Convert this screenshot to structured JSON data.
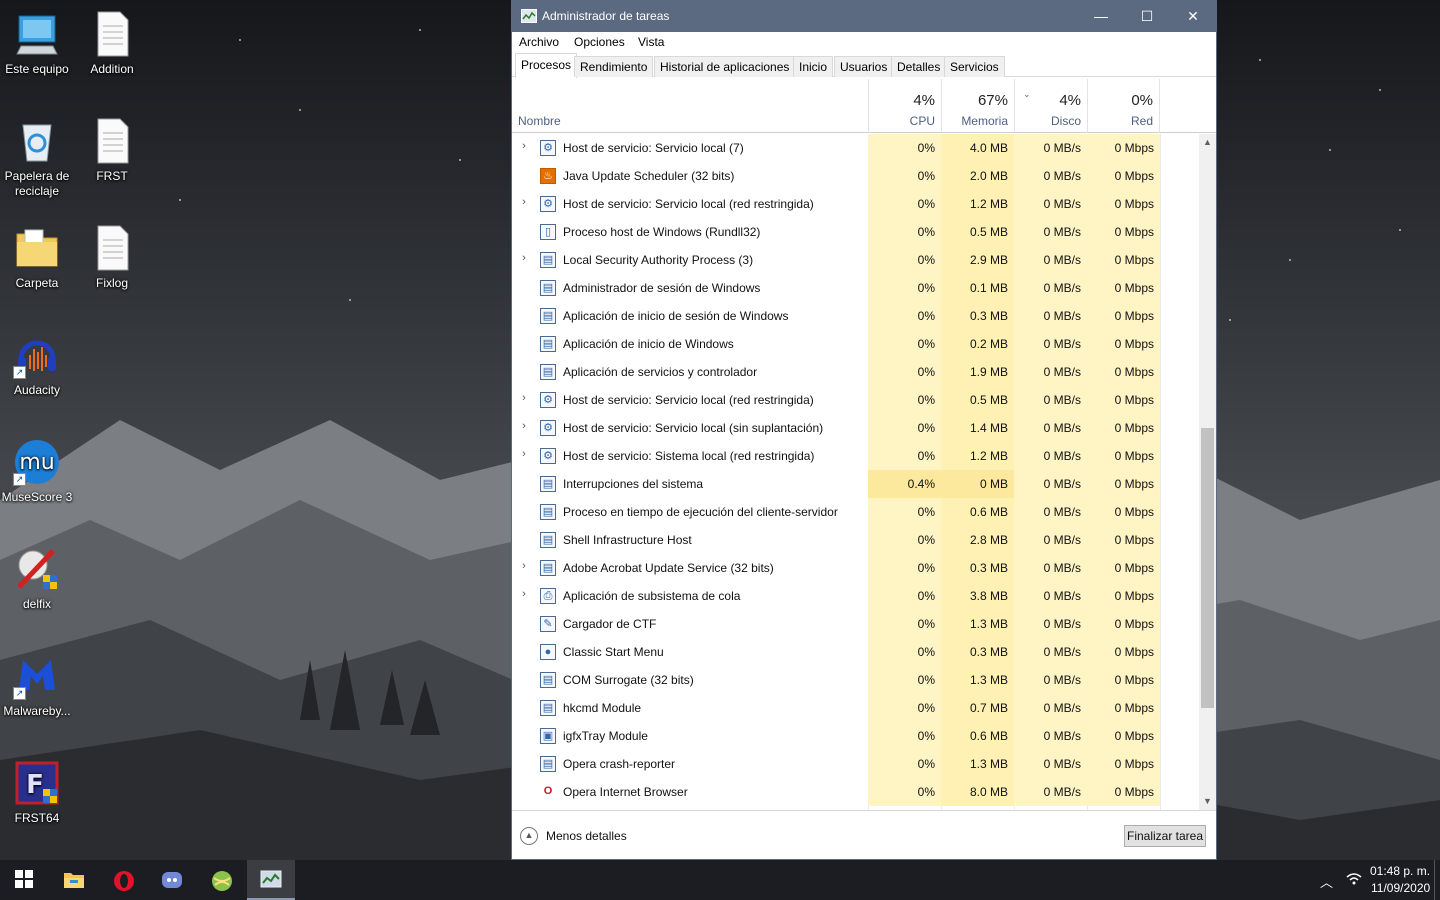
{
  "desktop": {
    "icons": [
      {
        "label": "Este equipo",
        "icon": "computer-icon"
      },
      {
        "label": "Addition",
        "icon": "text-file-icon"
      },
      {
        "label": "Papelera de reciclaje",
        "icon": "recycle-bin-icon"
      },
      {
        "label": "FRST",
        "icon": "text-file-icon"
      },
      {
        "label": "Carpeta",
        "icon": "folder-icon"
      },
      {
        "label": "Fixlog",
        "icon": "text-file-icon"
      },
      {
        "label": "Audacity",
        "icon": "audacity-icon"
      },
      {
        "label": "MuseScore 3",
        "icon": "musescore-icon"
      },
      {
        "label": "delfix",
        "icon": "delfix-icon"
      },
      {
        "label": "Malwareby...",
        "icon": "malwarebytes-icon"
      },
      {
        "label": "FRST64",
        "icon": "frst64-icon"
      }
    ]
  },
  "window": {
    "title": "Administrador de tareas",
    "controls": {
      "minimize": "—",
      "maximize": "☐",
      "close": "✕"
    }
  },
  "menu": {
    "file": "Archivo",
    "options": "Opciones",
    "view": "Vista"
  },
  "tabs": [
    "Procesos",
    "Rendimiento",
    "Historial de aplicaciones",
    "Inicio",
    "Usuarios",
    "Detalles",
    "Servicios"
  ],
  "active_tab": "Procesos",
  "columns": {
    "name": "Nombre",
    "cpu": {
      "pct": "4%",
      "label": "CPU"
    },
    "memory": {
      "pct": "67%",
      "label": "Memoria"
    },
    "disk": {
      "pct": "4%",
      "label": "Disco"
    },
    "network": {
      "pct": "0%",
      "label": "Red"
    }
  },
  "processes": [
    {
      "name": "Host de servicio: Servicio local (7)",
      "expand": true,
      "icon": "gear-icon",
      "cpu": "0%",
      "mem": "4.0 MB",
      "disk": "0 MB/s",
      "net": "0 Mbps"
    },
    {
      "name": "Java Update Scheduler (32 bits)",
      "expand": false,
      "icon": "java-icon",
      "cpu": "0%",
      "mem": "2.0 MB",
      "disk": "0 MB/s",
      "net": "0 Mbps"
    },
    {
      "name": "Host de servicio: Servicio local (red restringida)",
      "expand": true,
      "icon": "gear-icon",
      "cpu": "0%",
      "mem": "1.2 MB",
      "disk": "0 MB/s",
      "net": "0 Mbps"
    },
    {
      "name": "Proceso host de Windows (Rundll32)",
      "expand": false,
      "icon": "page-icon",
      "cpu": "0%",
      "mem": "0.5 MB",
      "disk": "0 MB/s",
      "net": "0 Mbps"
    },
    {
      "name": "Local Security Authority Process (3)",
      "expand": true,
      "icon": "window-icon",
      "cpu": "0%",
      "mem": "2.9 MB",
      "disk": "0 MB/s",
      "net": "0 Mbps"
    },
    {
      "name": "Administrador de sesión de Windows",
      "expand": false,
      "icon": "window-icon",
      "cpu": "0%",
      "mem": "0.1 MB",
      "disk": "0 MB/s",
      "net": "0 Mbps"
    },
    {
      "name": "Aplicación de inicio de sesión de Windows",
      "expand": false,
      "icon": "window-icon",
      "cpu": "0%",
      "mem": "0.3 MB",
      "disk": "0 MB/s",
      "net": "0 Mbps"
    },
    {
      "name": "Aplicación de inicio de Windows",
      "expand": false,
      "icon": "window-icon",
      "cpu": "0%",
      "mem": "0.2 MB",
      "disk": "0 MB/s",
      "net": "0 Mbps"
    },
    {
      "name": "Aplicación de servicios y controlador",
      "expand": false,
      "icon": "window-icon",
      "cpu": "0%",
      "mem": "1.9 MB",
      "disk": "0 MB/s",
      "net": "0 Mbps"
    },
    {
      "name": "Host de servicio: Servicio local (red restringida)",
      "expand": true,
      "icon": "gear-icon",
      "cpu": "0%",
      "mem": "0.5 MB",
      "disk": "0 MB/s",
      "net": "0 Mbps"
    },
    {
      "name": "Host de servicio: Servicio local (sin suplantación)",
      "expand": true,
      "icon": "gear-icon",
      "cpu": "0%",
      "mem": "1.4 MB",
      "disk": "0 MB/s",
      "net": "0 Mbps"
    },
    {
      "name": "Host de servicio: Sistema local (red restringida)",
      "expand": true,
      "icon": "gear-icon",
      "cpu": "0%",
      "mem": "1.2 MB",
      "disk": "0 MB/s",
      "net": "0 Mbps"
    },
    {
      "name": "Interrupciones del sistema",
      "expand": false,
      "icon": "window-icon",
      "cpu": "0.4%",
      "mem": "0 MB",
      "disk": "0 MB/s",
      "net": "0 Mbps",
      "hot": true
    },
    {
      "name": "Proceso en tiempo de ejecución del cliente-servidor",
      "expand": false,
      "icon": "window-icon",
      "cpu": "0%",
      "mem": "0.6 MB",
      "disk": "0 MB/s",
      "net": "0 Mbps"
    },
    {
      "name": "Shell Infrastructure Host",
      "expand": false,
      "icon": "window-icon",
      "cpu": "0%",
      "mem": "2.8 MB",
      "disk": "0 MB/s",
      "net": "0 Mbps"
    },
    {
      "name": "Adobe Acrobat Update Service (32 bits)",
      "expand": true,
      "icon": "window-icon",
      "cpu": "0%",
      "mem": "0.3 MB",
      "disk": "0 MB/s",
      "net": "0 Mbps"
    },
    {
      "name": "Aplicación de subsistema de cola",
      "expand": true,
      "icon": "printer-icon",
      "cpu": "0%",
      "mem": "3.8 MB",
      "disk": "0 MB/s",
      "net": "0 Mbps"
    },
    {
      "name": "Cargador de CTF",
      "expand": false,
      "icon": "pen-icon",
      "cpu": "0%",
      "mem": "1.3 MB",
      "disk": "0 MB/s",
      "net": "0 Mbps"
    },
    {
      "name": "Classic Start Menu",
      "expand": false,
      "icon": "shell-icon",
      "cpu": "0%",
      "mem": "0.3 MB",
      "disk": "0 MB/s",
      "net": "0 Mbps"
    },
    {
      "name": "COM Surrogate (32 bits)",
      "expand": false,
      "icon": "window-icon",
      "cpu": "0%",
      "mem": "1.3 MB",
      "disk": "0 MB/s",
      "net": "0 Mbps"
    },
    {
      "name": "hkcmd Module",
      "expand": false,
      "icon": "window-icon",
      "cpu": "0%",
      "mem": "0.7 MB",
      "disk": "0 MB/s",
      "net": "0 Mbps"
    },
    {
      "name": "igfxTray Module",
      "expand": false,
      "icon": "monitor-icon",
      "cpu": "0%",
      "mem": "0.6 MB",
      "disk": "0 MB/s",
      "net": "0 Mbps"
    },
    {
      "name": "Opera crash-reporter",
      "expand": false,
      "icon": "window-icon",
      "cpu": "0%",
      "mem": "1.3 MB",
      "disk": "0 MB/s",
      "net": "0 Mbps"
    },
    {
      "name": "Opera Internet Browser",
      "expand": false,
      "icon": "opera-icon",
      "cpu": "0%",
      "mem": "8.0 MB",
      "disk": "0 MB/s",
      "net": "0 Mbps"
    }
  ],
  "footer": {
    "less_details": "Menos detalles",
    "end_task": "Finalizar tarea"
  },
  "taskbar": {
    "apps": [
      "start-icon",
      "file-explorer-icon",
      "opera-icon",
      "discord-icon",
      "globe-app-icon",
      "task-manager-icon"
    ],
    "time": "01:48 p. m.",
    "date": "11/09/2020"
  },
  "colors": {
    "accent": "#5b6a80",
    "cell_heat": "#fff4c4",
    "cell_hot": "#fde99d"
  }
}
